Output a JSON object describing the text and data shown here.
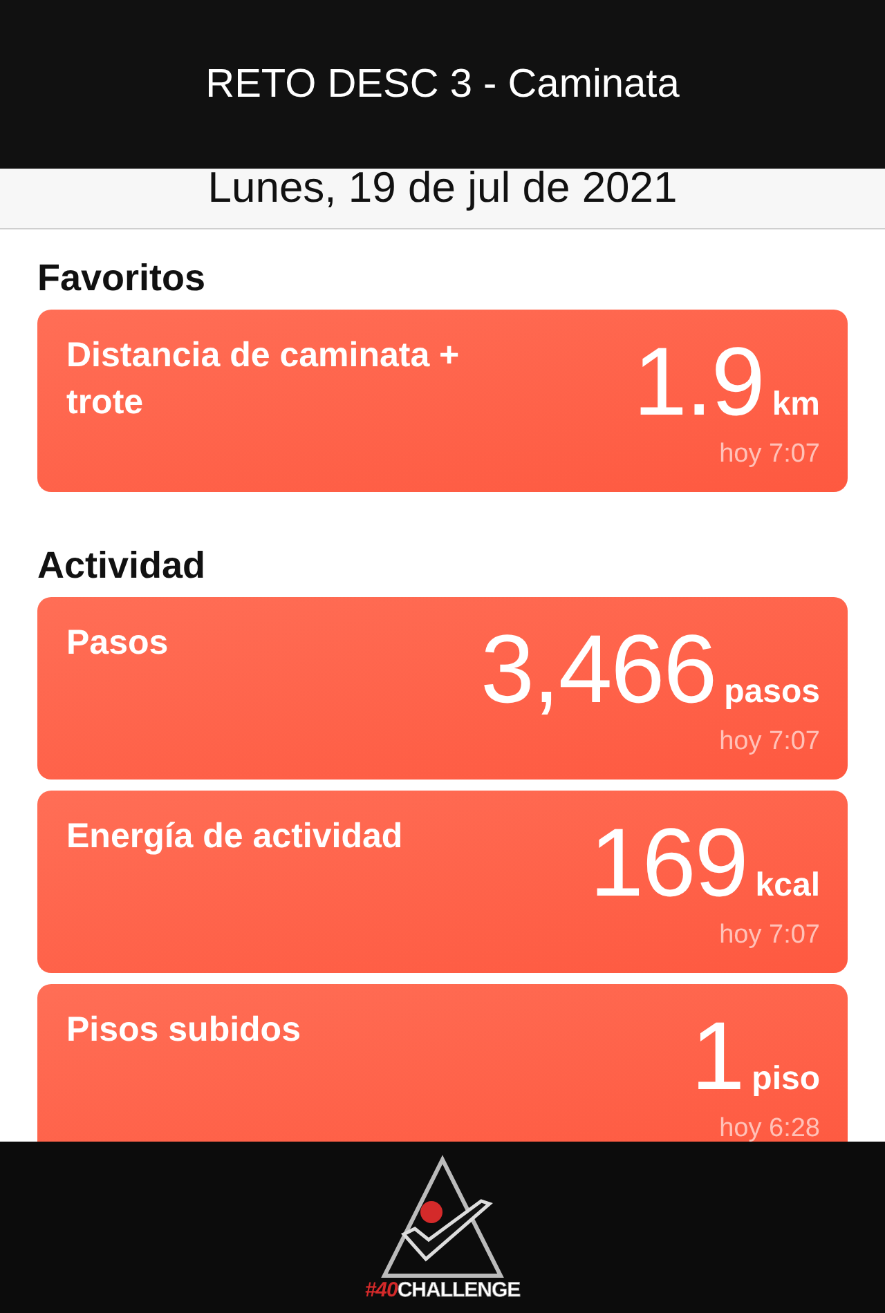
{
  "header": {
    "title": "RETO DESC 3 - Caminata"
  },
  "date": "Lunes, 19 de jul de 2021",
  "sections": [
    {
      "heading": "Favoritos",
      "cards": [
        {
          "title": "Distancia de caminata + trote",
          "value": "1.9",
          "unit": "km",
          "time": "hoy 7:07"
        }
      ]
    },
    {
      "heading": "Actividad",
      "cards": [
        {
          "title": "Pasos",
          "value": "3,466",
          "unit": "pasos",
          "time": "hoy 7:07"
        },
        {
          "title": "Energía de actividad",
          "value": "169",
          "unit": "kcal",
          "time": "hoy 7:07"
        },
        {
          "title": "Pisos subidos",
          "value": "1",
          "unit": "piso",
          "time": "hoy 6:28"
        }
      ]
    }
  ],
  "footer": {
    "logo_mark": "#40",
    "logo_word": "CHALLENGE"
  }
}
